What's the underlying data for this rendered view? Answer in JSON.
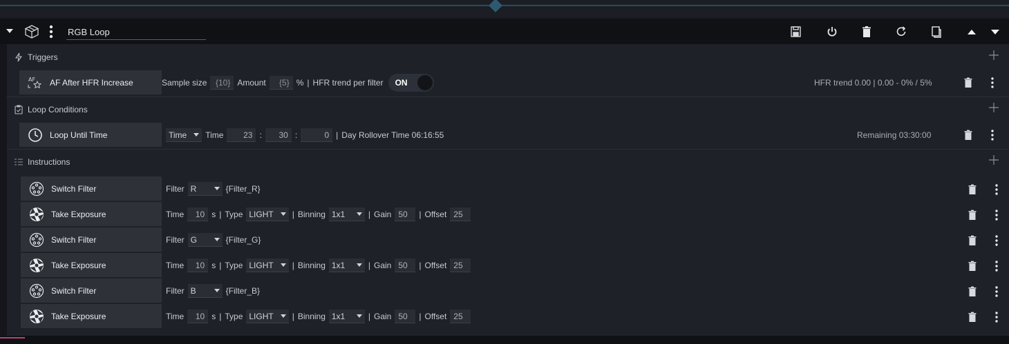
{
  "container": {
    "title": "RGB Loop"
  },
  "sections": {
    "triggers": "Triggers",
    "conditions": "Loop Conditions",
    "instructions": "Instructions"
  },
  "trigger": {
    "name": "AF After HFR Increase",
    "icon_text": "AF",
    "sample_size_label": "Sample size",
    "sample_size": "{10}",
    "amount_label": "Amount",
    "amount": "{5}",
    "percent": "%",
    "sep": "|",
    "trend_label": "HFR trend per filter",
    "toggle": "ON",
    "info": "HFR trend 0.00 | 0.00 - 0% / 5%"
  },
  "condition": {
    "name": "Loop Until Time",
    "mode": "Time",
    "time_label": "Time",
    "hour": "23",
    "minute": "30",
    "second": "0",
    "colon": ":",
    "sep": "|",
    "rollover_label": "Day Rollover Time 06:16:55",
    "remaining": "Remaining 03:30:00"
  },
  "instructions": [
    {
      "name": "Switch Filter",
      "filter_label": "Filter",
      "filter": "R",
      "token": "{Filter_R}"
    },
    {
      "name": "Take Exposure",
      "time_label": "Time",
      "time": "10",
      "unit": "s",
      "type_label": "Type",
      "type": "LIGHT",
      "binning_label": "Binning",
      "binning": "1x1",
      "gain_label": "Gain",
      "gain": "50",
      "offset_label": "Offset",
      "offset": "25"
    },
    {
      "name": "Switch Filter",
      "filter_label": "Filter",
      "filter": "G",
      "token": "{Filter_G}"
    },
    {
      "name": "Take Exposure",
      "time_label": "Time",
      "time": "10",
      "unit": "s",
      "type_label": "Type",
      "type": "LIGHT",
      "binning_label": "Binning",
      "binning": "1x1",
      "gain_label": "Gain",
      "gain": "50",
      "offset_label": "Offset",
      "offset": "25"
    },
    {
      "name": "Switch Filter",
      "filter_label": "Filter",
      "filter": "B",
      "token": "{Filter_B}"
    },
    {
      "name": "Take Exposure",
      "time_label": "Time",
      "time": "10",
      "unit": "s",
      "type_label": "Type",
      "type": "LIGHT",
      "binning_label": "Binning",
      "binning": "1x1",
      "gain_label": "Gain",
      "gain": "50",
      "offset_label": "Offset",
      "offset": "25"
    }
  ],
  "sep": "|",
  "icons": {
    "header": [
      "collapse-caret-icon",
      "container-box-icon",
      "more-vertical-icon",
      "save-icon",
      "power-icon",
      "delete-icon",
      "reset-icon",
      "copy-icon",
      "move-up-icon",
      "move-down-icon"
    ],
    "sections": [
      "lightning-icon",
      "clipboard-icon",
      "list-icon",
      "add-icon"
    ],
    "items": [
      "af-star-icon",
      "clock-icon",
      "filter-wheel-icon",
      "shutter-icon",
      "trash-icon",
      "kebab-icon"
    ]
  },
  "colors": {
    "background": "#14161b",
    "panel": "#1e2128",
    "card": "#2e3138",
    "accent": "#2e5a70",
    "pink": "#c03a86"
  }
}
